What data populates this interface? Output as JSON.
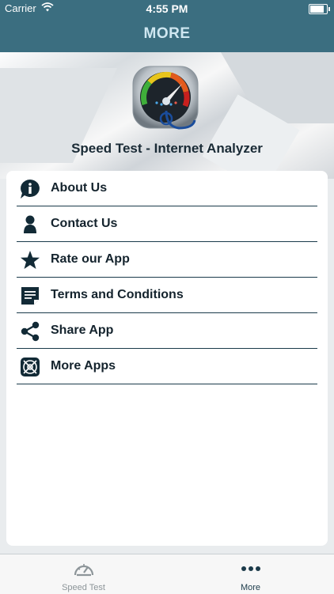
{
  "status": {
    "carrier": "Carrier",
    "time": "4:55 PM",
    "battery_level": 0.95
  },
  "nav": {
    "title": "MORE"
  },
  "hero": {
    "app_name": "Speed Test - Internet Analyzer"
  },
  "menu": {
    "items": [
      {
        "label": "About Us",
        "icon": "info-icon"
      },
      {
        "label": "Contact Us",
        "icon": "person-icon"
      },
      {
        "label": "Rate our App",
        "icon": "star-icon"
      },
      {
        "label": "Terms and Conditions",
        "icon": "document-icon"
      },
      {
        "label": "Share App",
        "icon": "share-icon"
      },
      {
        "label": "More Apps",
        "icon": "apps-icon"
      }
    ]
  },
  "tabs": [
    {
      "label": "Speed Test",
      "icon": "speedometer-icon",
      "active": false
    },
    {
      "label": "More",
      "icon": "more-dots-icon",
      "active": true
    }
  ],
  "colors": {
    "nav_bg": "#3b6e80",
    "nav_title": "#cfe7f1",
    "tab_active": "#1c3b4a",
    "tab_inactive": "#8d9599"
  }
}
